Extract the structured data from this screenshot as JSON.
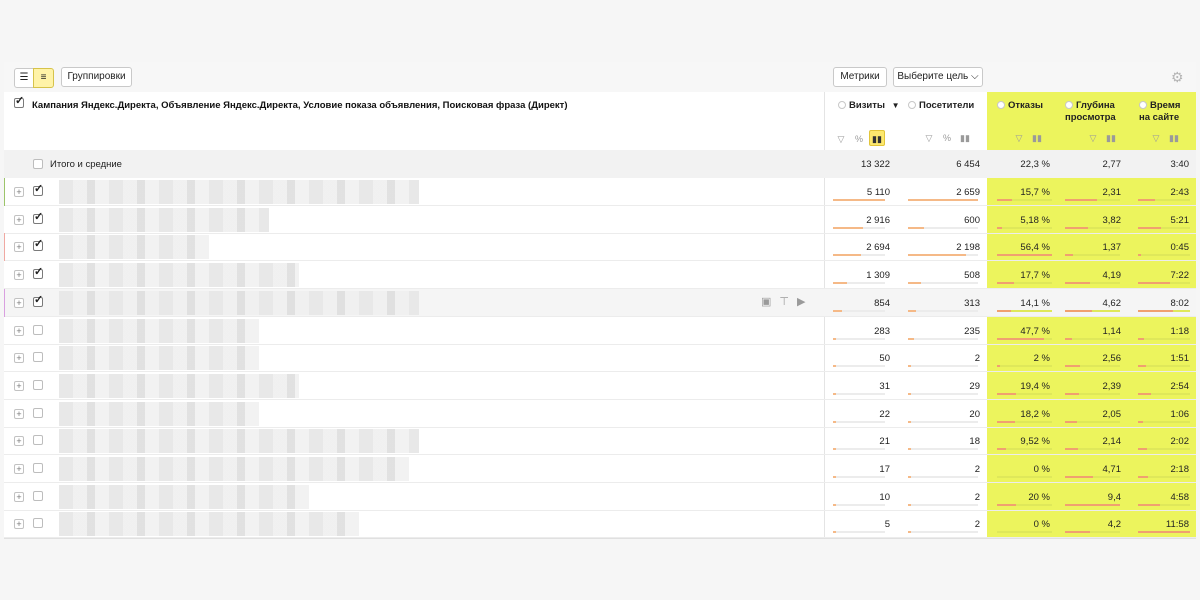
{
  "toolbar": {
    "view_list_icon": "list-icon",
    "view_tree_icon": "tree-icon",
    "group_label": "Группировки",
    "metrics_label": "Метрики",
    "goal_label": "Выберите цель",
    "settings_icon": "gear-icon"
  },
  "header": {
    "dimensions_label": "Кампания Яндекс.Директа, Объявление Яндекс.Директа, Условие показа объявления, Поисковая фраза (Директ)",
    "columns": [
      {
        "label": "Визиты",
        "label2": "",
        "sort": "▼"
      },
      {
        "label": "Посетители",
        "label2": "",
        "sort": ""
      },
      {
        "label": "Отказы",
        "label2": "",
        "sort": ""
      },
      {
        "label": "Глубина",
        "label2": "просмотра",
        "sort": ""
      },
      {
        "label": "Время",
        "label2": "на сайте",
        "sort": ""
      }
    ]
  },
  "totals": {
    "label": "Итого и средние",
    "values": [
      "13 322",
      "6 454",
      "22,3 %",
      "2,77",
      "3:40"
    ]
  },
  "colors": {
    "highlight": "#ecf45d",
    "bar": "#f5b987",
    "marker_1": "#9cc46a",
    "marker_2": "#f0a9a2",
    "marker_3": "#d9a0e0"
  },
  "rows": [
    {
      "checked": true,
      "marker": "#9cc46a",
      "values": [
        "5 110",
        "2 659",
        "15,7 %",
        "2,31",
        "2:43"
      ],
      "bars": [
        1.0,
        1.0,
        0.28,
        0.58,
        0.33
      ]
    },
    {
      "checked": true,
      "marker": "",
      "values": [
        "2 916",
        "600",
        "5,18 %",
        "3,82",
        "5:21"
      ],
      "bars": [
        0.57,
        0.23,
        0.09,
        0.41,
        0.45
      ]
    },
    {
      "checked": true,
      "marker": "#f0a9a2",
      "values": [
        "2 694",
        "2 198",
        "56,4 %",
        "1,37",
        "0:45"
      ],
      "bars": [
        0.53,
        0.83,
        1.0,
        0.15,
        0.06
      ]
    },
    {
      "checked": true,
      "marker": "",
      "values": [
        "1 309",
        "508",
        "17,7 %",
        "4,19",
        "7:22"
      ],
      "bars": [
        0.26,
        0.19,
        0.31,
        0.45,
        0.62
      ]
    },
    {
      "checked": true,
      "marker": "#d9a0e0",
      "hover": true,
      "values": [
        "854",
        "313",
        "14,1 %",
        "4,62",
        "8:02"
      ],
      "bars": [
        0.17,
        0.12,
        0.25,
        0.49,
        0.68
      ]
    },
    {
      "checked": false,
      "marker": "",
      "values": [
        "283",
        "235",
        "47,7 %",
        "1,14",
        "1:18"
      ],
      "bars": [
        0.06,
        0.09,
        0.85,
        0.12,
        0.11
      ]
    },
    {
      "checked": false,
      "marker": "",
      "values": [
        "50",
        "2",
        "2 %",
        "2,56",
        "1:51"
      ],
      "bars": [
        0.01,
        0.01,
        0.04,
        0.27,
        0.16
      ]
    },
    {
      "checked": false,
      "marker": "",
      "values": [
        "31",
        "29",
        "19,4 %",
        "2,39",
        "2:54"
      ],
      "bars": [
        0.01,
        0.01,
        0.34,
        0.25,
        0.25
      ]
    },
    {
      "checked": false,
      "marker": "",
      "values": [
        "22",
        "20",
        "18,2 %",
        "2,05",
        "1:06"
      ],
      "bars": [
        0.01,
        0.01,
        0.32,
        0.22,
        0.09
      ]
    },
    {
      "checked": false,
      "marker": "",
      "values": [
        "21",
        "18",
        "9,52 %",
        "2,14",
        "2:02"
      ],
      "bars": [
        0.01,
        0.01,
        0.17,
        0.23,
        0.17
      ]
    },
    {
      "checked": false,
      "marker": "",
      "values": [
        "17",
        "2",
        "0 %",
        "4,71",
        "2:18"
      ],
      "bars": [
        0.01,
        0.01,
        0.0,
        0.5,
        0.19
      ]
    },
    {
      "checked": false,
      "marker": "",
      "values": [
        "10",
        "2",
        "20 %",
        "9,4",
        "4:58"
      ],
      "bars": [
        0.01,
        0.01,
        0.35,
        1.0,
        0.42
      ]
    },
    {
      "checked": false,
      "marker": "",
      "values": [
        "5",
        "2",
        "0 %",
        "4,2",
        "11:58"
      ],
      "bars": [
        0.01,
        0.01,
        0.0,
        0.45,
        1.0
      ]
    }
  ],
  "row_actions": [
    "save-icon",
    "filter-icon",
    "play-icon"
  ]
}
